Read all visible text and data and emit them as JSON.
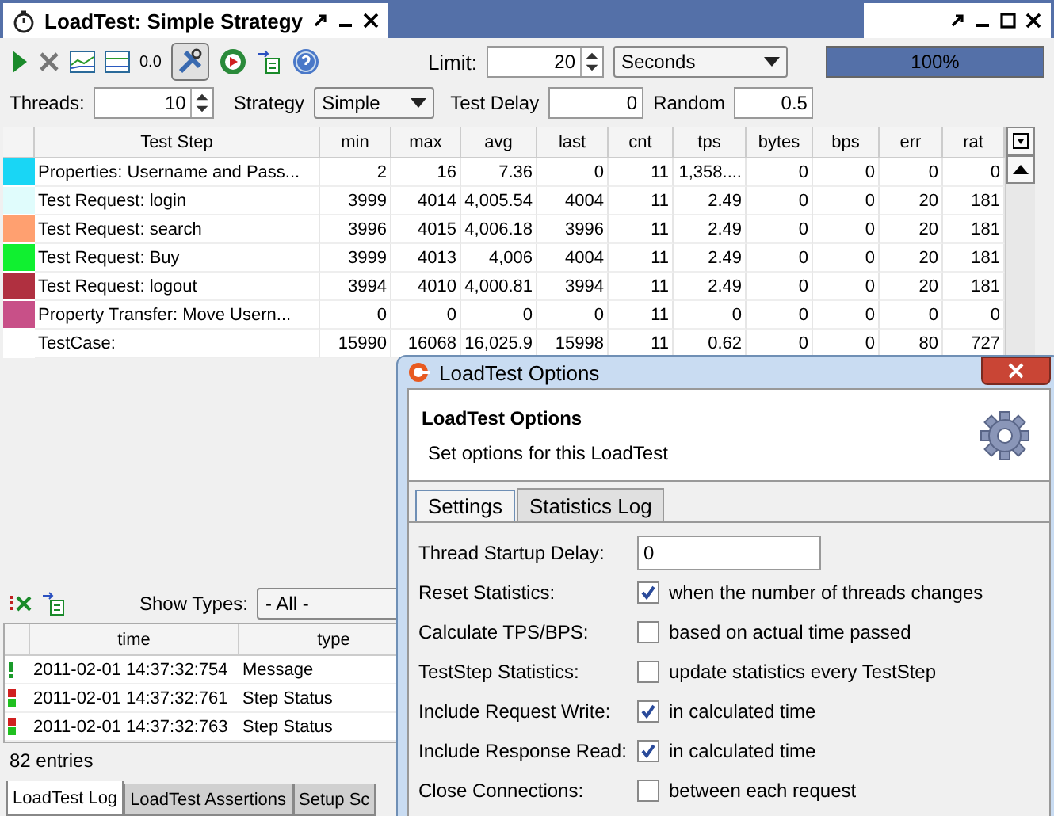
{
  "document_tab": {
    "title": "LoadTest: Simple Strategy"
  },
  "toolbar": {
    "decimal_label": "0.0",
    "limit_label": "Limit:",
    "limit": "20",
    "limit_unit": "Seconds",
    "progress": {
      "level": 1,
      "text": "100%"
    }
  },
  "settings": {
    "threads_label": "Threads:",
    "threads": "10",
    "strategy_label": "Strategy",
    "strategy": "Simple",
    "delay_label": "Test Delay",
    "delay": "0",
    "random_label": "Random",
    "random": "0.5"
  },
  "stats_table": {
    "columns": [
      "Test Step",
      "min",
      "max",
      "avg",
      "last",
      "cnt",
      "tps",
      "bytes",
      "bps",
      "err",
      "rat"
    ],
    "rows": [
      {
        "color": "#19d6f5",
        "cells": [
          "Properties: Username and Pass...",
          "2",
          "16",
          "7.36",
          "0",
          "11",
          "1,358....",
          "0",
          "0",
          "0",
          "0"
        ]
      },
      {
        "color": "#e0fcfc",
        "cells": [
          "Test Request: login",
          "3999",
          "4014",
          "4,005.54",
          "4004",
          "11",
          "2.49",
          "0",
          "0",
          "20",
          "181"
        ]
      },
      {
        "color": "#ffa070",
        "cells": [
          "Test Request: search",
          "3996",
          "4015",
          "4,006.18",
          "3996",
          "11",
          "2.49",
          "0",
          "0",
          "20",
          "181"
        ]
      },
      {
        "color": "#10f030",
        "cells": [
          "Test Request: Buy",
          "3999",
          "4013",
          "4,006",
          "4004",
          "11",
          "2.49",
          "0",
          "0",
          "20",
          "181"
        ]
      },
      {
        "color": "#b03040",
        "cells": [
          "Test Request: logout",
          "3994",
          "4010",
          "4,000.81",
          "3994",
          "11",
          "2.49",
          "0",
          "0",
          "20",
          "181"
        ]
      },
      {
        "color": "#c85088",
        "cells": [
          "Property Transfer: Move Usern...",
          "0",
          "0",
          "0",
          "0",
          "11",
          "0",
          "0",
          "0",
          "0",
          "0"
        ]
      },
      {
        "cells": [
          "TestCase:",
          "15990",
          "16068",
          "16,025.9",
          "15998",
          "11",
          "0.62",
          "0",
          "0",
          "80",
          "727"
        ]
      }
    ]
  },
  "log": {
    "show_types_label": "Show Types:",
    "show_types": "- All -",
    "columns": [
      "time",
      "type"
    ],
    "rows": [
      {
        "kind": "message",
        "time": "2011-02-01 14:37:32:754",
        "type": "Message"
      },
      {
        "kind": "status",
        "time": "2011-02-01 14:37:32:761",
        "type": "Step Status"
      },
      {
        "kind": "status",
        "time": "2011-02-01 14:37:32:763",
        "type": "Step Status"
      }
    ],
    "entries": "82 entries"
  },
  "bottom_tabs": [
    {
      "label": "LoadTest Log",
      "selected": true
    },
    {
      "label": "LoadTest Assertions",
      "selected": false
    },
    {
      "label": "Setup Sc",
      "selected": false
    }
  ],
  "dialog": {
    "title": "LoadTest Options",
    "heading": "LoadTest Options",
    "subtitle": "Set options for this LoadTest",
    "tabs": [
      {
        "label": "Settings",
        "selected": true
      },
      {
        "label": "Statistics Log",
        "selected": false
      }
    ],
    "fields": [
      {
        "kind": "text",
        "label": "Thread Startup Delay:",
        "value": "0"
      },
      {
        "kind": "checkbox",
        "label": "Reset Statistics:",
        "checked": true,
        "text": "when the number of threads changes"
      },
      {
        "kind": "checkbox",
        "label": "Calculate TPS/BPS:",
        "checked": false,
        "text": "based on actual time passed"
      },
      {
        "kind": "checkbox",
        "label": "TestStep Statistics:",
        "checked": false,
        "text": "update statistics every TestStep"
      },
      {
        "kind": "checkbox",
        "label": "Include Request Write:",
        "checked": true,
        "text": "in calculated time"
      },
      {
        "kind": "checkbox",
        "label": "Include Response Read:",
        "checked": true,
        "text": "in calculated time"
      },
      {
        "kind": "checkbox",
        "label": "Close Connections:",
        "checked": false,
        "text": "between each request"
      }
    ]
  }
}
